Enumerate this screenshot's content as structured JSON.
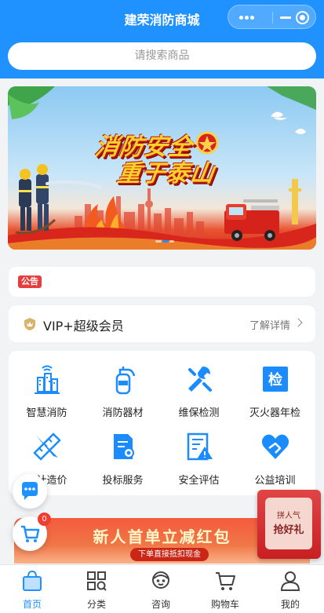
{
  "header": {
    "title": "建荣消防商城",
    "bg_color": "#1f92ff"
  },
  "capsule": {
    "icons": [
      "more-dots-icon",
      "minimize-icon",
      "close-target-icon"
    ]
  },
  "search": {
    "placeholder": "请搜索商品"
  },
  "banner": {
    "line1": "消防安全",
    "line2": "重于泰山",
    "page_count": 3,
    "active_page": 2
  },
  "notice": {
    "tag": "公告"
  },
  "vip": {
    "label": "VIP+超级会员",
    "more": "了解详情"
  },
  "services": [
    {
      "label": "智慧消防",
      "icon": "smart-city-icon"
    },
    {
      "label": "消防器材",
      "icon": "fire-extinguisher-icon"
    },
    {
      "label": "维保检测",
      "icon": "wrench-screwdriver-icon"
    },
    {
      "label": "灭火器年检",
      "icon": "inspection-check-icon"
    },
    {
      "label": "设计造价",
      "icon": "ruler-pencil-icon"
    },
    {
      "label": "投标服务",
      "icon": "bid-document-icon"
    },
    {
      "label": "安全评估",
      "icon": "warning-document-icon"
    },
    {
      "label": "公益培训",
      "icon": "heart-hand-icon"
    }
  ],
  "accent_color": "#1a8cff",
  "promo": {
    "title": "新人首单立减红包",
    "subtitle": "下单直接抵扣现金"
  },
  "floating": {
    "cart_badge": "0"
  },
  "red_packet": {
    "line1": "拼人气",
    "line2": "抢好礼"
  },
  "tabbar": [
    {
      "label": "首页",
      "icon": "home-bag-icon",
      "active": true
    },
    {
      "label": "分类",
      "icon": "category-grid-icon",
      "active": false
    },
    {
      "label": "咨询",
      "icon": "consult-avatar-icon",
      "active": false
    },
    {
      "label": "购物车",
      "icon": "cart-icon",
      "active": false
    },
    {
      "label": "我的",
      "icon": "user-icon",
      "active": false
    }
  ]
}
